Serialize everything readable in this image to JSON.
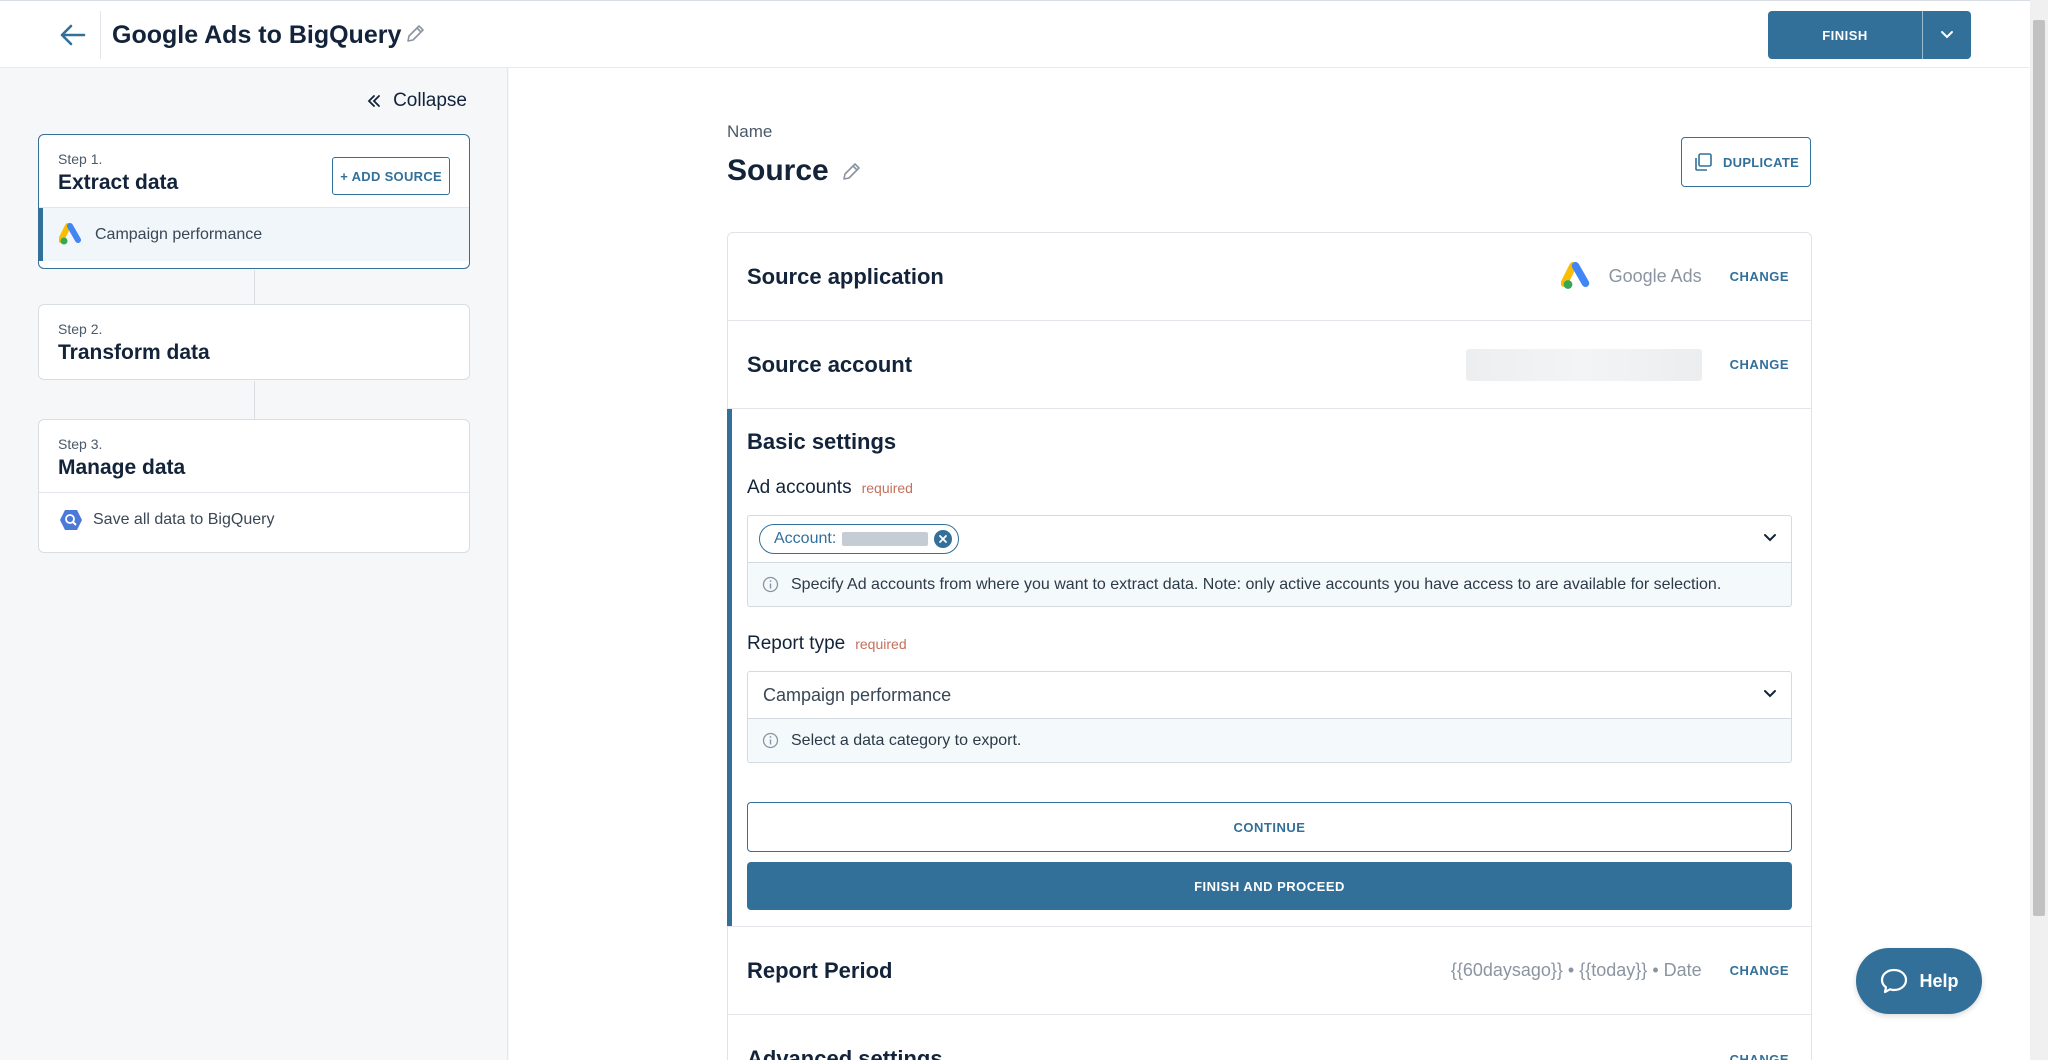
{
  "header": {
    "title": "Google Ads to BigQuery",
    "finish_label": "FINISH"
  },
  "sidebar": {
    "collapse_label": "Collapse",
    "steps": [
      {
        "number": "Step 1.",
        "name": "Extract data",
        "action_label": "+ ADD SOURCE",
        "item": "Campaign performance"
      },
      {
        "number": "Step 2.",
        "name": "Transform data"
      },
      {
        "number": "Step 3.",
        "name": "Manage data",
        "item": "Save all data to BigQuery"
      }
    ]
  },
  "main": {
    "name_label": "Name",
    "title": "Source",
    "duplicate_label": "DUPLICATE",
    "source_application": {
      "title": "Source application",
      "value": "Google Ads",
      "change": "CHANGE"
    },
    "source_account": {
      "title": "Source account",
      "change": "CHANGE"
    },
    "basic_settings": {
      "title": "Basic settings",
      "ad_accounts": {
        "label": "Ad accounts",
        "required": "required",
        "chip_label": "Account:",
        "hint": "Specify Ad accounts from where you want to extract data. Note: only active accounts you have access to are available for selection."
      },
      "report_type": {
        "label": "Report type",
        "required": "required",
        "value": "Campaign performance",
        "hint": "Select a data category to export."
      },
      "continue_label": "CONTINUE",
      "finish_proceed_label": "FINISH AND PROCEED"
    },
    "report_period": {
      "title": "Report Period",
      "value": "{{60daysago}} • {{today}} • Date",
      "change": "CHANGE"
    },
    "advanced_settings": {
      "title": "Advanced settings",
      "change": "CHANGE"
    }
  },
  "help_label": "Help",
  "colors": {
    "accent": "#32709a",
    "required": "#c4705c"
  }
}
